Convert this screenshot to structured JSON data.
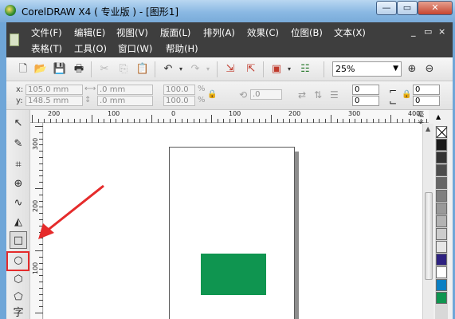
{
  "window": {
    "title": "CorelDRAW X4 ( 专业版 ) - [图形1]",
    "minimize_glyph": "—",
    "restore_glyph": "▭",
    "close_glyph": "✕"
  },
  "menubar": {
    "row1": [
      "文件(F)",
      "编辑(E)",
      "视图(V)",
      "版面(L)",
      "排列(A)",
      "效果(C)",
      "位图(B)",
      "文本(X)"
    ],
    "row2": [
      "表格(T)",
      "工具(O)",
      "窗口(W)",
      "帮助(H)"
    ],
    "mdi_buttons": [
      "_",
      "▭",
      "×"
    ]
  },
  "standard_toolbar": {
    "zoom_value": "25%",
    "icons": [
      "new-icon",
      "open-icon",
      "save-icon",
      "print-icon",
      "cut-icon",
      "copy-icon",
      "paste-icon",
      "undo-icon",
      "redo-icon",
      "import-icon",
      "export-icon",
      "application-launcher-icon",
      "welcome-screen-icon",
      "zoom-in-icon",
      "zoom-out-icon"
    ]
  },
  "property_bar": {
    "x_label": "x:",
    "y_label": "y:",
    "x_value": "105.0 mm",
    "y_value": "148.5 mm",
    "width_value": ".0 mm",
    "height_value": ".0 mm",
    "scale_x": "100.0",
    "scale_y": "100.0",
    "percent": "%",
    "rotation_value": ".0",
    "corner_values": [
      "0",
      "0",
      "0",
      "0"
    ]
  },
  "rulers": {
    "top_labels": [
      "200",
      "100",
      "0",
      "100",
      "200",
      "300",
      "400"
    ],
    "unit": "毫米",
    "left_labels": [
      "300",
      "200",
      "100"
    ]
  },
  "toolbox": {
    "tools": [
      {
        "name": "pick-tool",
        "glyph": "↖"
      },
      {
        "name": "shape-tool",
        "glyph": "✎"
      },
      {
        "name": "crop-tool",
        "glyph": "⌗"
      },
      {
        "name": "zoom-tool",
        "glyph": "⊕"
      },
      {
        "name": "freehand-tool",
        "glyph": "∿"
      },
      {
        "name": "smart-fill-tool",
        "glyph": "◭"
      },
      {
        "name": "rectangle-tool",
        "glyph": "□"
      },
      {
        "name": "ellipse-tool",
        "glyph": "○"
      },
      {
        "name": "polygon-tool",
        "glyph": "⬡"
      },
      {
        "name": "basic-shapes-tool",
        "glyph": "⬠"
      },
      {
        "name": "text-tool",
        "glyph": "字"
      }
    ]
  },
  "palette": {
    "colors": [
      "#ffffff",
      "#1a1a1a",
      "#333333",
      "#4d4d4d",
      "#666666",
      "#808080",
      "#999999",
      "#b3b3b3",
      "#cccccc",
      "#e6e6e6",
      "#2e2281",
      "#ffffff",
      "#0b7fc3",
      "#0f9550"
    ]
  },
  "colors": {
    "rectangle_fill": "#0f9550",
    "highlight": "#e52b2b"
  }
}
